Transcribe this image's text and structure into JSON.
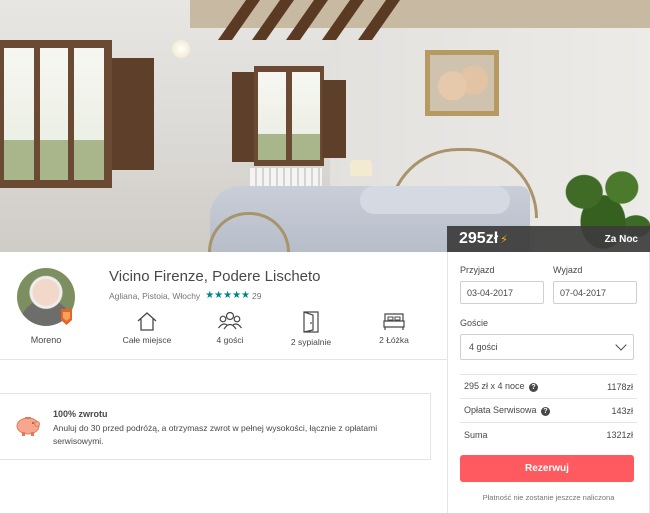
{
  "price_bar": {
    "price": "295zł",
    "per": "Za Noc",
    "instant_book_icon": "lightning-bolt-icon",
    "bolt_color": "#ffb400"
  },
  "booking": {
    "checkin_label": "Przyjazd",
    "checkin_value": "03-04-2017",
    "checkout_label": "Wyjazd",
    "checkout_value": "07-04-2017",
    "guests_label": "Goście",
    "guests_value": "4 gości",
    "rows": [
      {
        "label": "295 zł x 4 noce",
        "value": "1178zł",
        "info": true
      },
      {
        "label": "Opłata Serwisowa",
        "value": "143zł",
        "info": true
      },
      {
        "label": "Suma",
        "value": "1321zł",
        "info": false
      }
    ],
    "reserve_label": "Rezerwuj",
    "note": "Płatność nie zostanie jeszcze naliczona",
    "accent": "#ff5a5f"
  },
  "listing": {
    "title": "Vicino Firenze, Podere Lischeto",
    "location": "Agliana, Pistoia, Włochy",
    "rating": 5,
    "review_count": "29",
    "star_color": "#008489",
    "host_name": "Moreno",
    "amenities": [
      {
        "icon": "house-icon",
        "label": "Całe miejsce"
      },
      {
        "icon": "guests-icon",
        "label": "4 gości"
      },
      {
        "icon": "door-icon",
        "label": "2 sypialnie"
      },
      {
        "icon": "bed-icon",
        "label": "2 Łóżka"
      }
    ]
  },
  "refund": {
    "icon": "piggy-bank-icon",
    "title": "100% zwrotu",
    "text": "Anuluj do 30 przed podróżą, a otrzymasz zwrot w pełnej wysokości, łącznie z opłatami serwisowymi."
  }
}
